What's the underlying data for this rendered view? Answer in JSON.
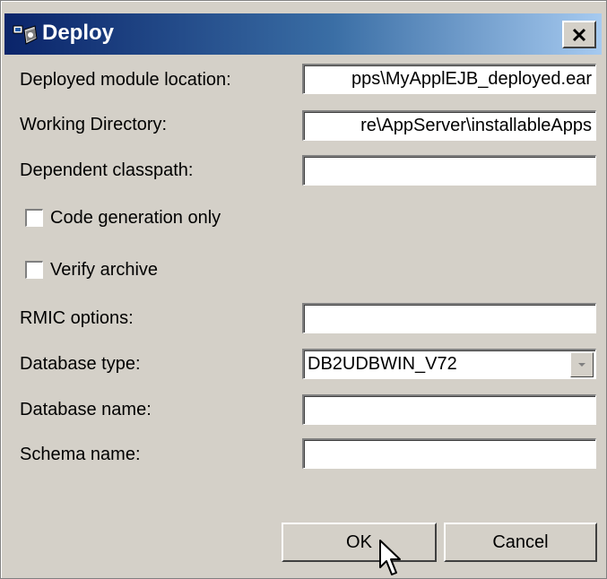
{
  "window": {
    "title": "Deploy",
    "icon": "deploy-icon",
    "close_icon": "close-icon"
  },
  "fields": {
    "deployed_module_location": {
      "label": "Deployed module location:",
      "value": "pps\\MyApplEJB_deployed.ear"
    },
    "working_directory": {
      "label": "Working Directory:",
      "value": "re\\AppServer\\installableApps"
    },
    "dependent_classpath": {
      "label": "Dependent classpath:",
      "value": ""
    },
    "rmic_options": {
      "label": "RMIC options:",
      "value": ""
    },
    "database_type": {
      "label": "Database type:",
      "selected": "DB2UDBWIN_V72"
    },
    "database_name": {
      "label": "Database name:",
      "value": ""
    },
    "schema_name": {
      "label": "Schema name:",
      "value": ""
    }
  },
  "checkboxes": {
    "code_generation_only": {
      "label": "Code generation only",
      "checked": false
    },
    "verify_archive": {
      "label": "Verify archive",
      "checked": false
    }
  },
  "buttons": {
    "ok_label": "OK",
    "cancel_label": "Cancel"
  },
  "colors": {
    "dialog_bg": "#d4d0c8",
    "titlebar_start": "#0a246a",
    "titlebar_end": "#a6caf0",
    "title_text": "#ffffff"
  }
}
